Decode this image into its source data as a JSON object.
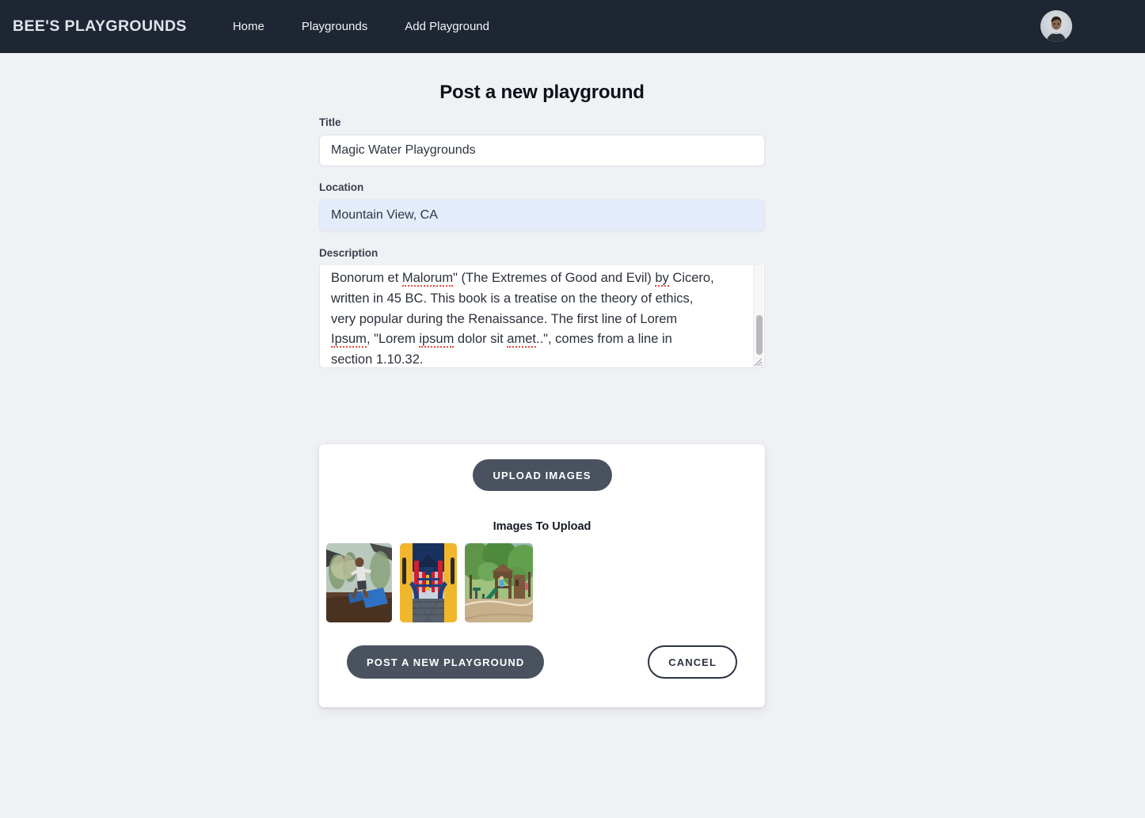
{
  "navbar": {
    "brand": "BEE'S PLAYGROUNDS",
    "links": [
      {
        "label": "Home"
      },
      {
        "label": "Playgrounds"
      },
      {
        "label": "Add Playground"
      }
    ],
    "avatar_icon": "user-avatar-photo",
    "background_color": "#1f2633"
  },
  "page": {
    "title": "Post a new playground",
    "background_color": "#eff1f5"
  },
  "form": {
    "title_field": {
      "label": "Title",
      "value": "Magic Water Playgrounds",
      "placeholder": "Title"
    },
    "location_field": {
      "label": "Location",
      "value": "Mountain View, CA",
      "placeholder": "Location",
      "autofill_color": "#e4ecfb"
    },
    "description_field": {
      "label": "Description",
      "placeholder": "Description",
      "visible_text_line1_a": "Bonorum et ",
      "visible_text_line1_b": "Malorum",
      "visible_text_line1_c": "\" (The Extremes of Good and Evil) ",
      "visible_text_line1_d": "by",
      "visible_text_line1_e": " Cicero,",
      "visible_text_line2": "written in 45 BC. This book is a treatise on the theory of ethics,",
      "visible_text_line3": "very popular during the Renaissance. The first line of Lorem",
      "visible_text_line4_a": "Ipsum",
      "visible_text_line4_b": ", \"Lorem ",
      "visible_text_line4_c": "ipsum",
      "visible_text_line4_d": " dolor sit ",
      "visible_text_line4_e": "amet",
      "visible_text_line4_f": "..\", comes from a line in",
      "visible_text_line5": "section 1.10.32."
    }
  },
  "upload_card": {
    "upload_button": "UPLOAD IMAGES",
    "images_heading": "Images To Upload",
    "thumbnails": [
      {
        "name": "playground-child-running-thumbnail"
      },
      {
        "name": "playground-yellow-red-structure-thumbnail"
      },
      {
        "name": "playground-wooden-structure-park-thumbnail"
      }
    ],
    "submit_button": "POST A NEW PLAYGROUND",
    "cancel_button": "CANCEL",
    "accent_color": "#4a5260"
  }
}
